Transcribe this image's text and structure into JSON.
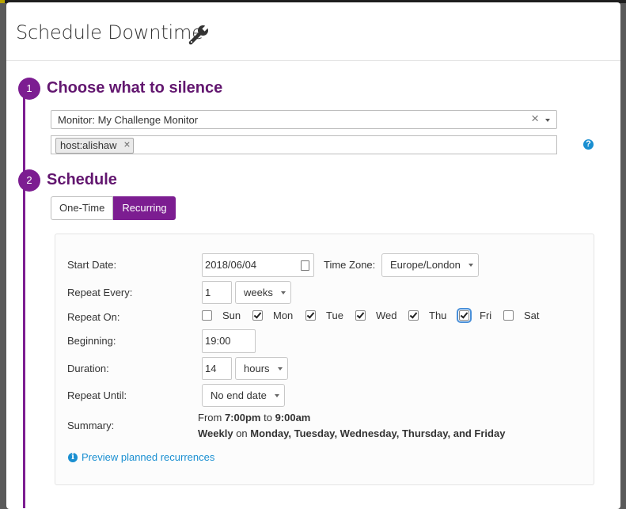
{
  "modal": {
    "title": "Schedule Downtime",
    "title_icon": "wrench-icon"
  },
  "step1": {
    "number": "1",
    "title": "Choose what to silence",
    "monitor_select": {
      "value": "Monitor: My Challenge Monitor",
      "clear": "×"
    },
    "scope_tags": [
      {
        "label": "host:alishaw",
        "remove": "×"
      }
    ],
    "help": "?"
  },
  "step2": {
    "number": "2",
    "title": "Schedule",
    "tabs": [
      {
        "label": "One-Time",
        "active": false
      },
      {
        "label": "Recurring",
        "active": true
      }
    ]
  },
  "form": {
    "start_date": {
      "label": "Start Date:",
      "value": "2018/06/04"
    },
    "time_zone": {
      "label": "Time Zone:",
      "value": "Europe/London"
    },
    "repeat_every": {
      "label": "Repeat Every:",
      "value": "1",
      "unit": "weeks"
    },
    "repeat_on": {
      "label": "Repeat On:",
      "days": [
        {
          "label": "Sun",
          "checked": false
        },
        {
          "label": "Mon",
          "checked": true
        },
        {
          "label": "Tue",
          "checked": true
        },
        {
          "label": "Wed",
          "checked": true
        },
        {
          "label": "Thu",
          "checked": true
        },
        {
          "label": "Fri",
          "checked": true
        },
        {
          "label": "Sat",
          "checked": false
        }
      ]
    },
    "beginning": {
      "label": "Beginning:",
      "value": "19:00"
    },
    "duration": {
      "label": "Duration:",
      "value": "14",
      "unit": "hours"
    },
    "repeat_until": {
      "label": "Repeat Until:",
      "value": "No end date"
    },
    "summary": {
      "label": "Summary:",
      "from_prefix": "From ",
      "from_time": "7:00pm",
      "to_word": " to ",
      "to_time": "9:00am",
      "frequency": "Weekly",
      "on_word": " on ",
      "days_text": "Monday, Tuesday, Wednesday, Thursday, and Friday"
    },
    "preview_link": "Preview planned recurrences",
    "preview_icon": "i"
  },
  "colors": {
    "accent": "#7c1d91",
    "link": "#1a8fd1"
  }
}
